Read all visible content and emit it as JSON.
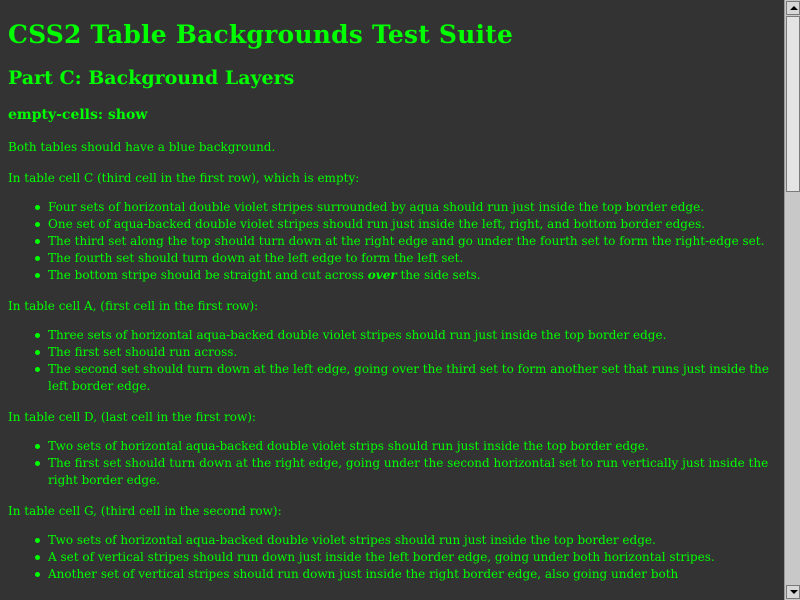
{
  "page": {
    "title": "CSS2 Table Backgrounds Test Suite",
    "part_heading": "Part C: Background Layers",
    "section_heading": "empty-cells: show",
    "colors": {
      "background": "#333333",
      "text": "#00ff00"
    }
  },
  "intro": "Both tables should have a blue background.",
  "sections": [
    {
      "lead": "In table cell C (third cell in the first row), which is empty:",
      "items": [
        "Four sets of horizontal double violet stripes surrounded by aqua should run just inside the top border edge.",
        "One set of aqua-backed double violet stripes should run just inside the left, right, and bottom border edges.",
        "The third set along the top should turn down at the right edge and go under the fourth set to form the right-edge set.",
        "The fourth set should turn down at the left edge to form the left set."
      ],
      "last_item": {
        "before": "The bottom stripe should be straight and cut across ",
        "emphasis": "over",
        "after": " the side sets."
      }
    },
    {
      "lead": "In table cell A, (first cell in the first row):",
      "items": [
        "Three sets of horizontal aqua-backed double violet stripes should run just inside the top border edge.",
        "The first set should run across.",
        "The second set should turn down at the left edge, going over the third set to form another set that runs just inside the left border edge."
      ]
    },
    {
      "lead": "In table cell D, (last cell in the first row):",
      "items": [
        "Two sets of horizontal aqua-backed double violet strips should run just inside the top border edge.",
        "The first set should turn down at the right edge, going under the second horizontal set to run vertically just inside the right border edge."
      ]
    },
    {
      "lead": "In table cell G, (third cell in the second row):",
      "items": [
        "Two sets of horizontal aqua-backed double violet stripes should run just inside the top border edge.",
        "A set of vertical stripes should run down just inside the left border edge, going under both horizontal stripes.",
        "Another set of vertical stripes should run down just inside the right border edge, also going under both"
      ]
    }
  ],
  "scrollbar": {
    "up_icon": "arrow-up-icon",
    "down_icon": "arrow-down-icon"
  }
}
